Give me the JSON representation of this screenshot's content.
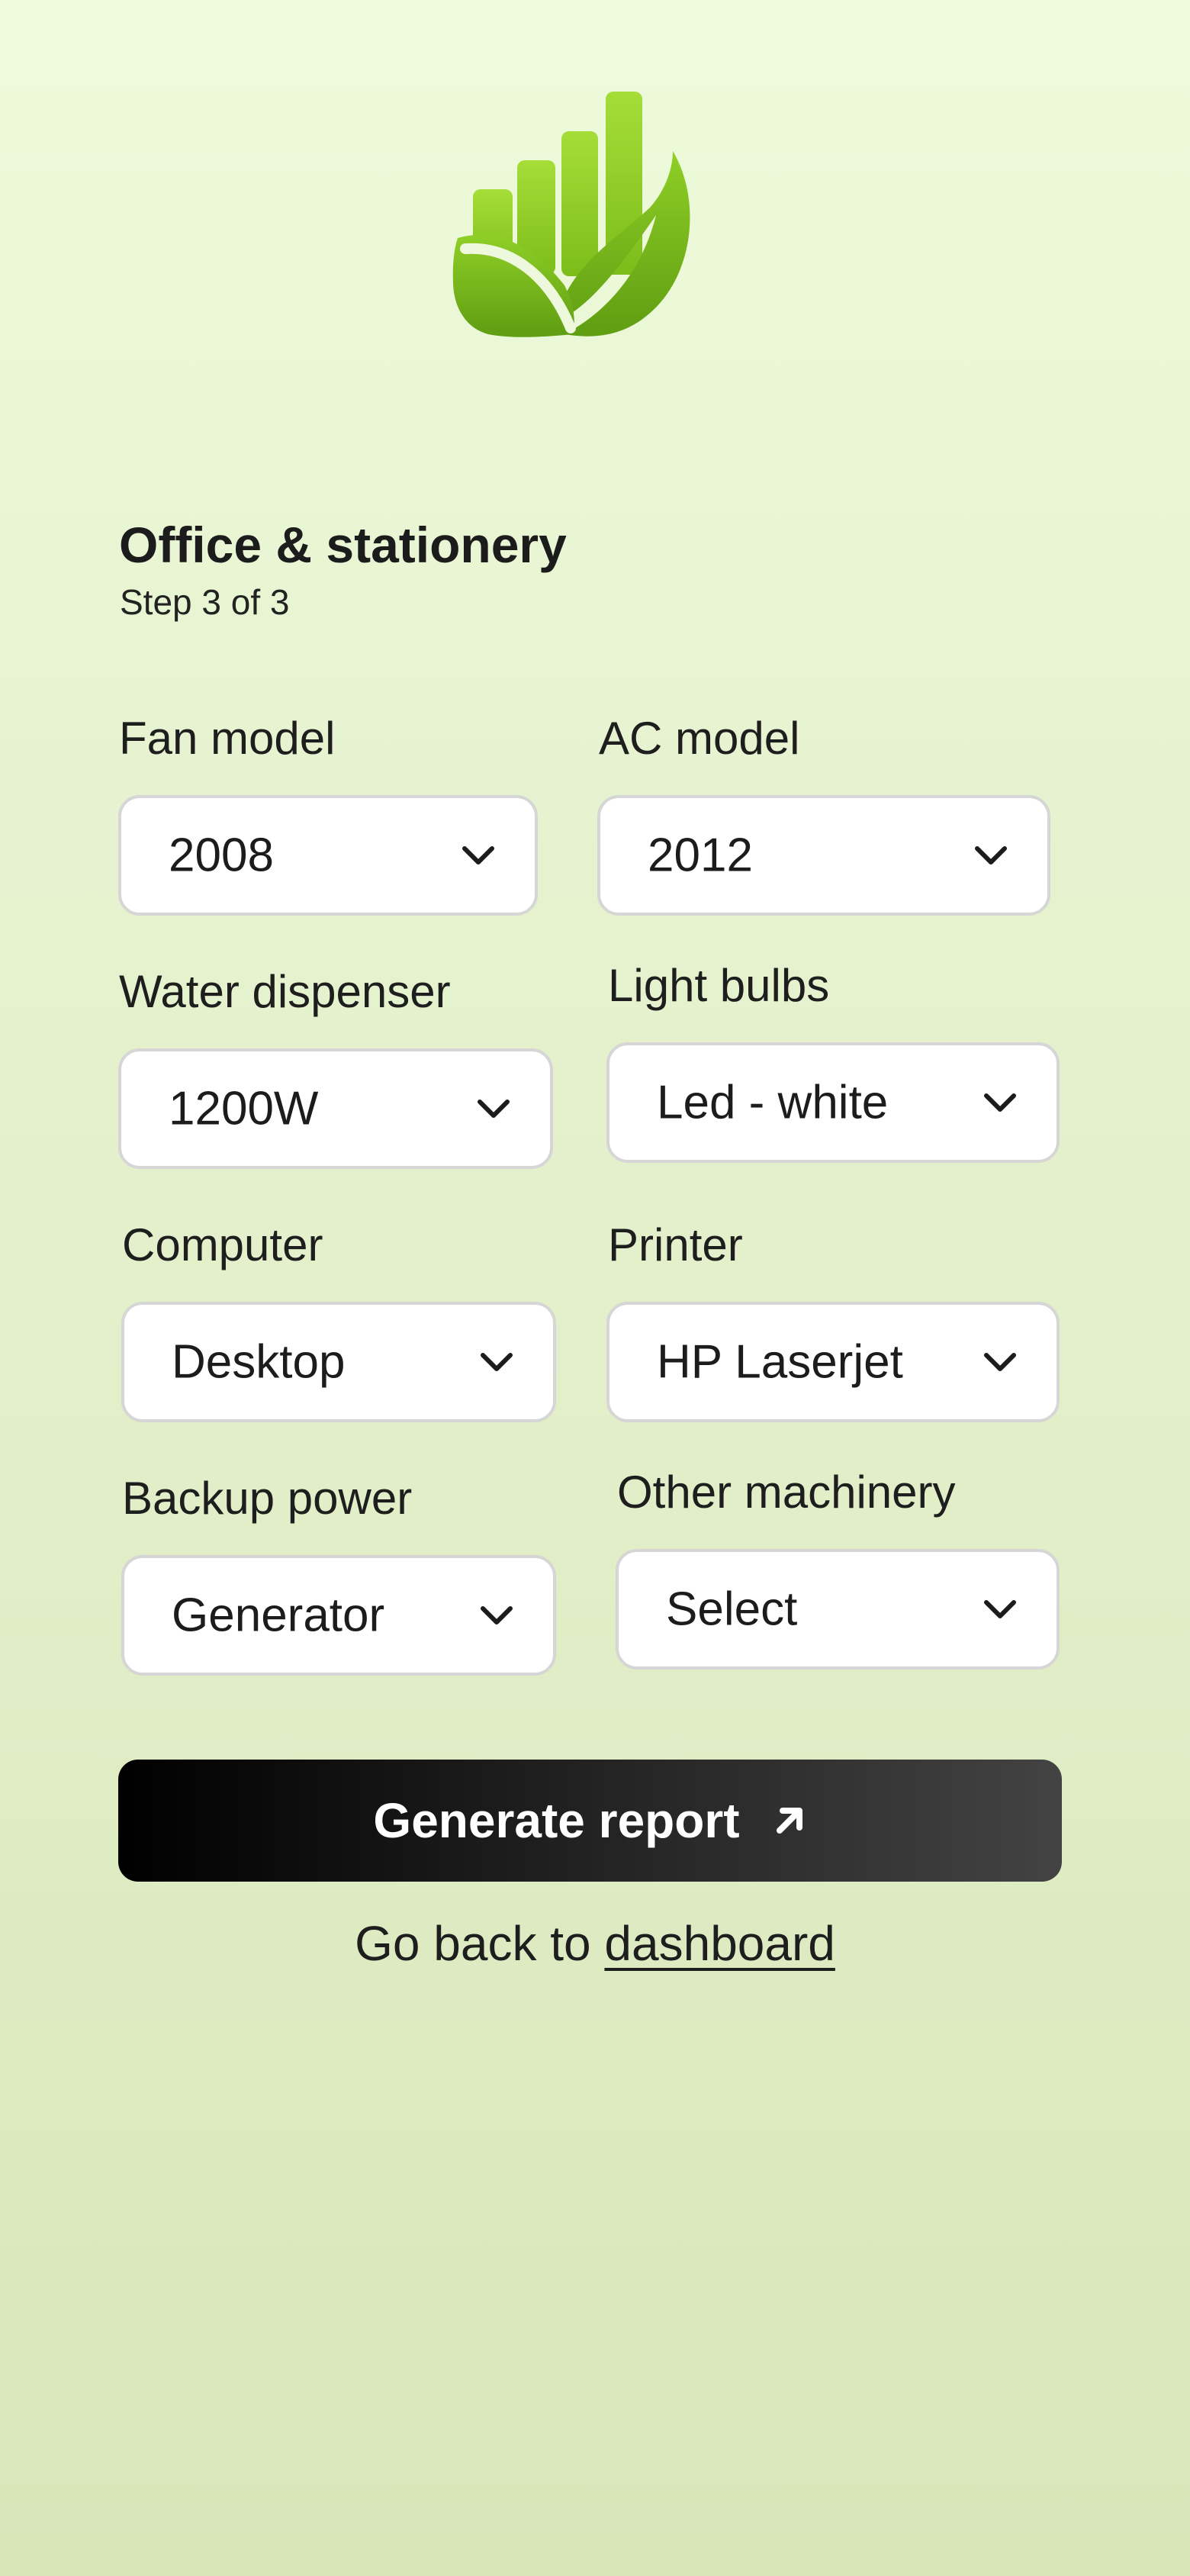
{
  "app": {
    "logo_icon": "growth-leaf-chart-logo",
    "accent_color": "#7cc119"
  },
  "header": {
    "title": "Office & stationery",
    "step": "Step 3 of 3"
  },
  "fields": {
    "fan_model": {
      "label": "Fan model",
      "value": "2008"
    },
    "ac_model": {
      "label": "AC model",
      "value": "2012"
    },
    "water_dispenser": {
      "label": "Water dispenser",
      "value": "1200W"
    },
    "light_bulbs": {
      "label": "Light bulbs",
      "value": "Led - white"
    },
    "computer": {
      "label": "Computer",
      "value": "Desktop"
    },
    "printer": {
      "label": "Printer",
      "value": "HP Laserjet"
    },
    "backup_power": {
      "label": "Backup power",
      "value": "Generator"
    },
    "other_machinery": {
      "label": "Other machinery",
      "value": "Select"
    }
  },
  "actions": {
    "generate_label": "Generate report",
    "generate_icon": "arrow-up-right-icon",
    "back_prefix": "Go back to",
    "back_link": "dashboard"
  }
}
